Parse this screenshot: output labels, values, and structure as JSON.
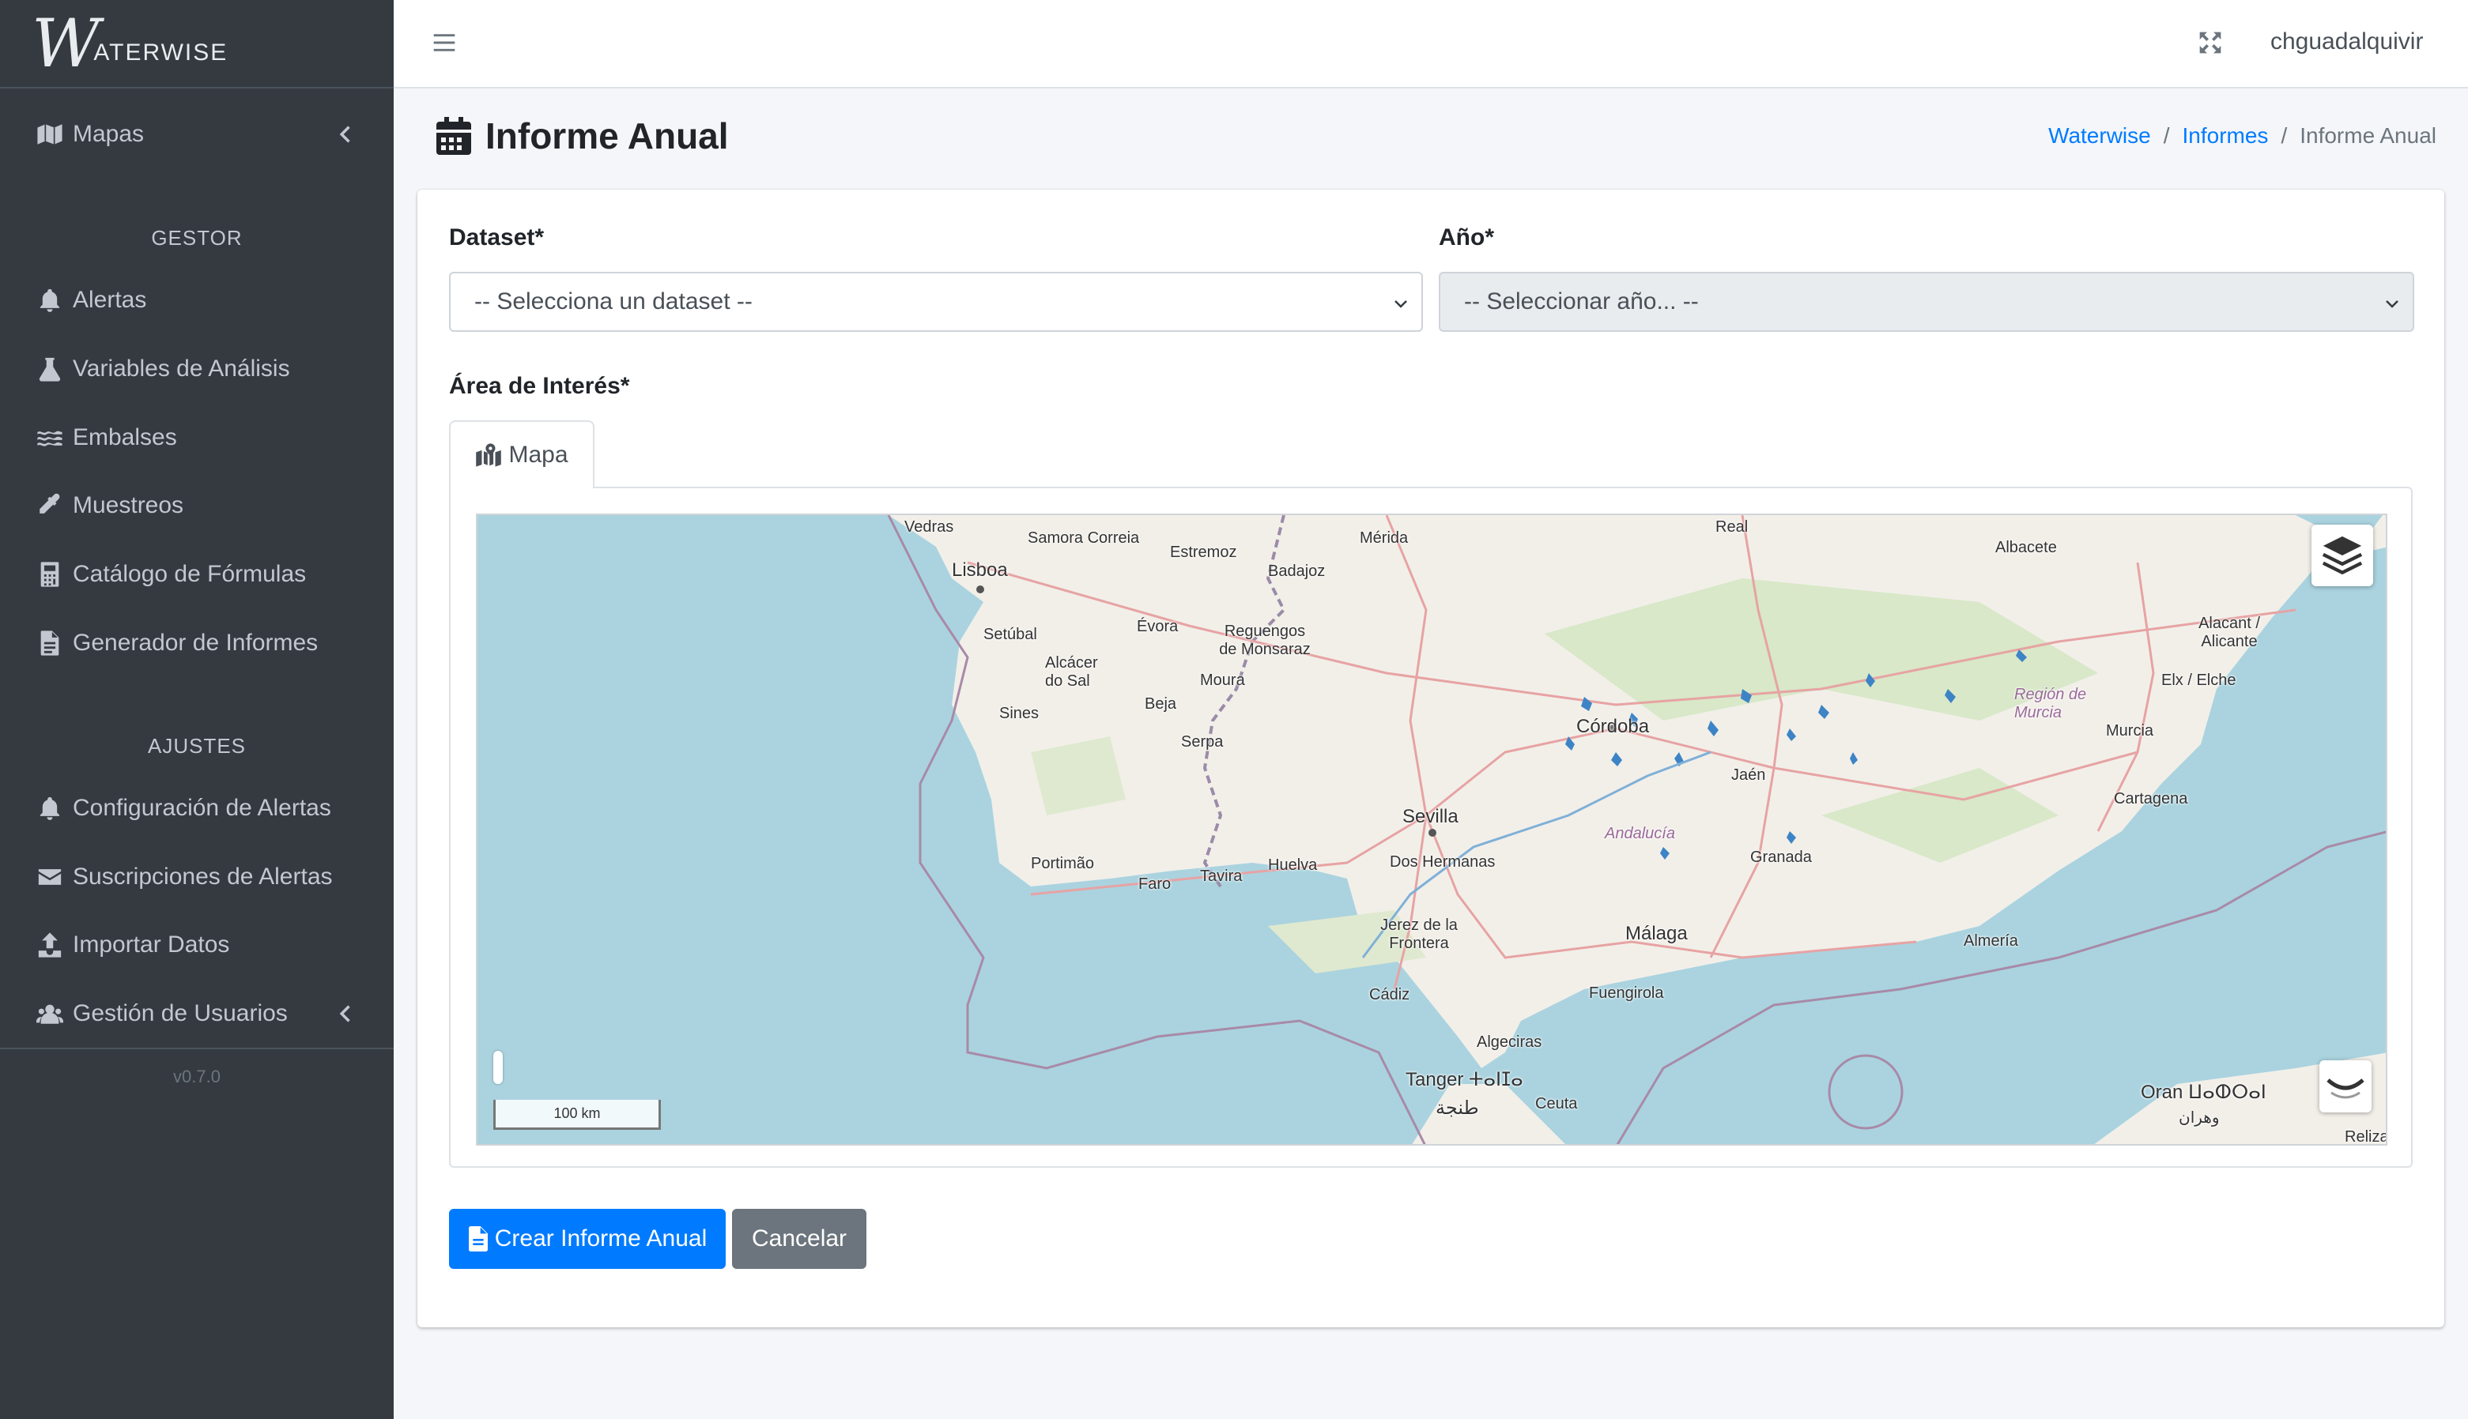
{
  "brand": {
    "logo_letter": "W",
    "logo_text": "ATERWISE"
  },
  "sidebar": {
    "top_items": [
      {
        "label": "Mapas",
        "icon": "map-icon"
      }
    ],
    "sections": [
      {
        "header": "GESTOR",
        "items": [
          {
            "label": "Alertas",
            "icon": "bell-icon"
          },
          {
            "label": "Variables de Análisis",
            "icon": "flask-icon"
          },
          {
            "label": "Embalses",
            "icon": "water-icon"
          },
          {
            "label": "Muestreos",
            "icon": "eyedropper-icon"
          },
          {
            "label": "Catálogo de Fórmulas",
            "icon": "calculator-icon"
          },
          {
            "label": "Generador de Informes",
            "icon": "file-alt-icon"
          }
        ]
      },
      {
        "header": "AJUSTES",
        "items": [
          {
            "label": "Configuración de Alertas",
            "icon": "bell-icon"
          },
          {
            "label": "Suscripciones de Alertas",
            "icon": "envelope-icon"
          },
          {
            "label": "Importar Datos",
            "icon": "upload-icon"
          },
          {
            "label": "Gestión de Usuarios",
            "icon": "users-icon"
          }
        ]
      }
    ],
    "version": "v0.7.0"
  },
  "topbar": {
    "username": "chguadalquivir"
  },
  "page": {
    "title": "Informe Anual",
    "breadcrumb": [
      "Waterwise",
      "Informes",
      "Informe Anual"
    ],
    "breadcrumb_sep": "/"
  },
  "form": {
    "dataset_label": "Dataset*",
    "dataset_value": "-- Selecciona un dataset --",
    "year_label": "Año*",
    "year_value": "-- Seleccionar año... --",
    "area_label": "Área de Interés*",
    "tab_label": "Mapa",
    "submit_label": "Crear Informe Anual",
    "cancel_label": "Cancelar"
  },
  "map": {
    "scale_label": "100 km",
    "places": [
      {
        "name": "Vedras"
      },
      {
        "name": "Samora Correia"
      },
      {
        "name": "Lisboa"
      },
      {
        "name": "Estremoz"
      },
      {
        "name": "Mérida"
      },
      {
        "name": "Real"
      },
      {
        "name": "Albacete"
      },
      {
        "name": "Badajoz"
      },
      {
        "name": "Setúbal"
      },
      {
        "name": "Évora"
      },
      {
        "name": "Reguengos de Monsaraz"
      },
      {
        "name": "Alacant / Alicante"
      },
      {
        "name": "Alcácer do Sal"
      },
      {
        "name": "Moura"
      },
      {
        "name": "Elx / Elche"
      },
      {
        "name": "Región de Murcia"
      },
      {
        "name": "Beja"
      },
      {
        "name": "Sines"
      },
      {
        "name": "Córdoba"
      },
      {
        "name": "Murcia"
      },
      {
        "name": "Serpa"
      },
      {
        "name": "Jaén"
      },
      {
        "name": "Cartagena"
      },
      {
        "name": "Sevilla"
      },
      {
        "name": "Andalucía"
      },
      {
        "name": "Portimão"
      },
      {
        "name": "Dos Hermanas"
      },
      {
        "name": "Granada"
      },
      {
        "name": "Huelva"
      },
      {
        "name": "Faro"
      },
      {
        "name": "Tavira"
      },
      {
        "name": "Jerez de la Frontera"
      },
      {
        "name": "Málaga"
      },
      {
        "name": "Almería"
      },
      {
        "name": "Cádiz"
      },
      {
        "name": "Fuengirola"
      },
      {
        "name": "Algeciras"
      },
      {
        "name": "Tanger ⵜⴰⵏⵊⴰ"
      },
      {
        "name": "Ceuta"
      },
      {
        "name": "طنجة"
      },
      {
        "name": "Oran ⵡⴰⵀⵔⴰⵏ"
      },
      {
        "name": "وهران"
      },
      {
        "name": "Reliza"
      }
    ]
  }
}
